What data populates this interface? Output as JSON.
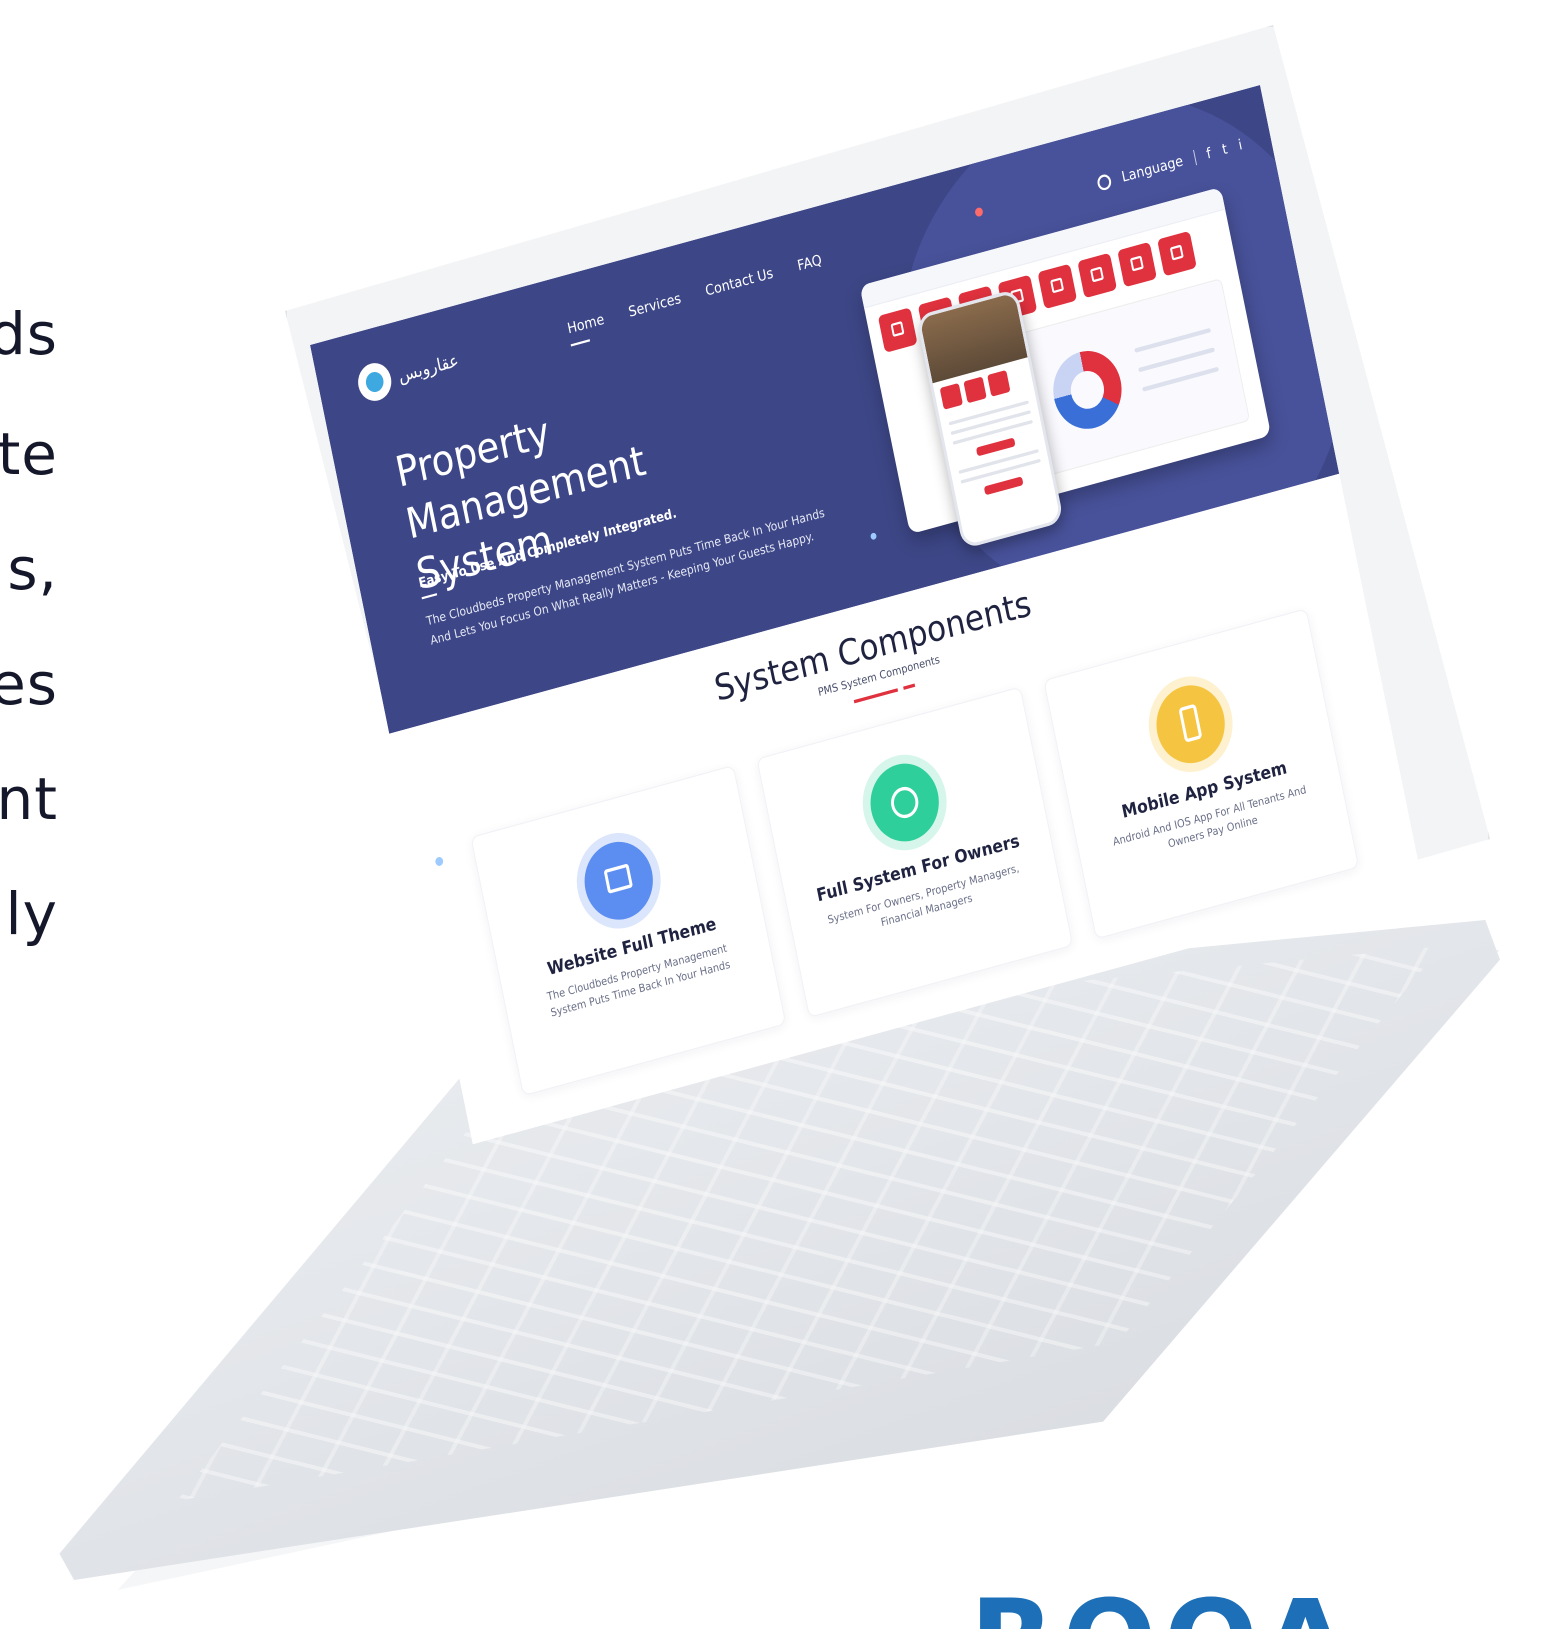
{
  "left_text_lines": [
    "ds",
    "te",
    "s,",
    "es",
    "nt",
    "ly"
  ],
  "brand": {
    "text": "ROOAY"
  },
  "site": {
    "logo_text": "عقاروبس",
    "nav": [
      {
        "label": "Home"
      },
      {
        "label": "Services"
      },
      {
        "label": "Contact Us"
      },
      {
        "label": "FAQ"
      }
    ],
    "language_label": "Language",
    "social": [
      "f",
      "t",
      "i"
    ]
  },
  "hero": {
    "title_line1": "Property Management",
    "title_line2": "System",
    "subtitle": "Easy To Use And Completely Integrated.",
    "description": "The Cloudbeds Property Management System Puts Time Back In Your Hands And Lets You Focus On What Really Matters - Keeping Your Guests Happy."
  },
  "components": {
    "title": "System Components",
    "subtitle": "PMS System Components",
    "cards": [
      {
        "icon": "laptop-icon",
        "title": "Website Full Theme",
        "desc": "The Cloudbeds Property Management System Puts Time Back In Your Hands"
      },
      {
        "icon": "network-icon",
        "title": "Full System For Owners",
        "desc": "System For Owners, Property Managers, Financial Managers"
      },
      {
        "icon": "mobile-icon",
        "title": "Mobile App System",
        "desc": "Android And IOS App For All Tenants And Owners Pay Online"
      }
    ]
  },
  "colors": {
    "hero_bg": "#3d4787",
    "accent_red": "#e0313e",
    "brand_blue": "#1d6fb8"
  }
}
